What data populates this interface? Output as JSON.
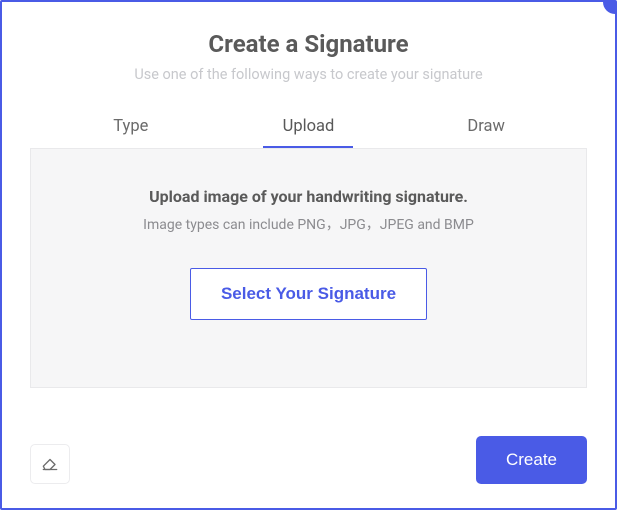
{
  "header": {
    "title": "Create a Signature",
    "subtitle": "Use one of the following ways to create your signature"
  },
  "tabs": {
    "type": "Type",
    "upload": "Upload",
    "draw": "Draw"
  },
  "upload_panel": {
    "heading": "Upload image of your handwriting signature.",
    "subtext": "Image types can include PNG，JPG，JPEG and BMP",
    "select_button": "Select Your Signature"
  },
  "footer": {
    "create_button": "Create"
  },
  "icons": {
    "eraser": "eraser"
  }
}
